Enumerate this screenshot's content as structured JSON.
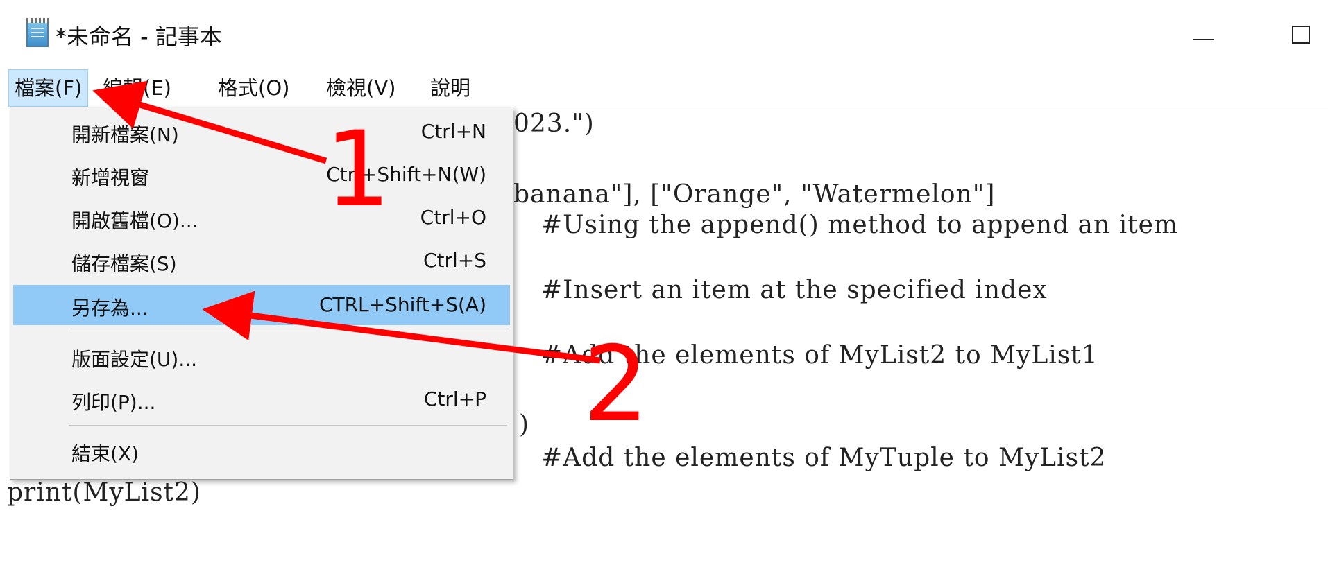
{
  "window": {
    "title": "*未命名 - 記事本"
  },
  "menubar": {
    "items": [
      {
        "label": "檔案(F)"
      },
      {
        "label": "編輯(E)"
      },
      {
        "label": "格式(O)"
      },
      {
        "label": "檢視(V)"
      },
      {
        "label": "說明"
      }
    ]
  },
  "editor": {
    "lines": [
      "023.\")",
      "banana\"], [\"Orange\", \"Watermelon\"]",
      "#Using the append() method to append an item",
      "#Insert an item at the specified index",
      "#Add the elements of MyList2 to MyList1",
      ")",
      "#Add the elements of MyTuple to MyList2",
      "print(MyList2)"
    ]
  },
  "file_menu": {
    "items": [
      {
        "label": "開新檔案(N)",
        "shortcut": "Ctrl+N"
      },
      {
        "label": "新增視窗",
        "shortcut": "Ctrl+Shift+N(W)"
      },
      {
        "label": "開啟舊檔(O)...",
        "shortcut": "Ctrl+O"
      },
      {
        "label": "儲存檔案(S)",
        "shortcut": "Ctrl+S"
      },
      {
        "label": "另存為...",
        "shortcut": "CTRL+Shift+S(A)"
      },
      {
        "label": "版面設定(U)...",
        "shortcut": ""
      },
      {
        "label": "列印(P)...",
        "shortcut": "Ctrl+P"
      },
      {
        "label": "結束(X)",
        "shortcut": ""
      }
    ]
  },
  "annotations": {
    "step1": "1",
    "step2": "2",
    "color": "#ff0000"
  },
  "colors": {
    "menu_highlight": "#91c9f7",
    "menubar_active": "#cce8ff"
  },
  "icons": {
    "app": "notepad-icon",
    "minimize": "minimize-icon",
    "maximize": "maximize-icon"
  }
}
